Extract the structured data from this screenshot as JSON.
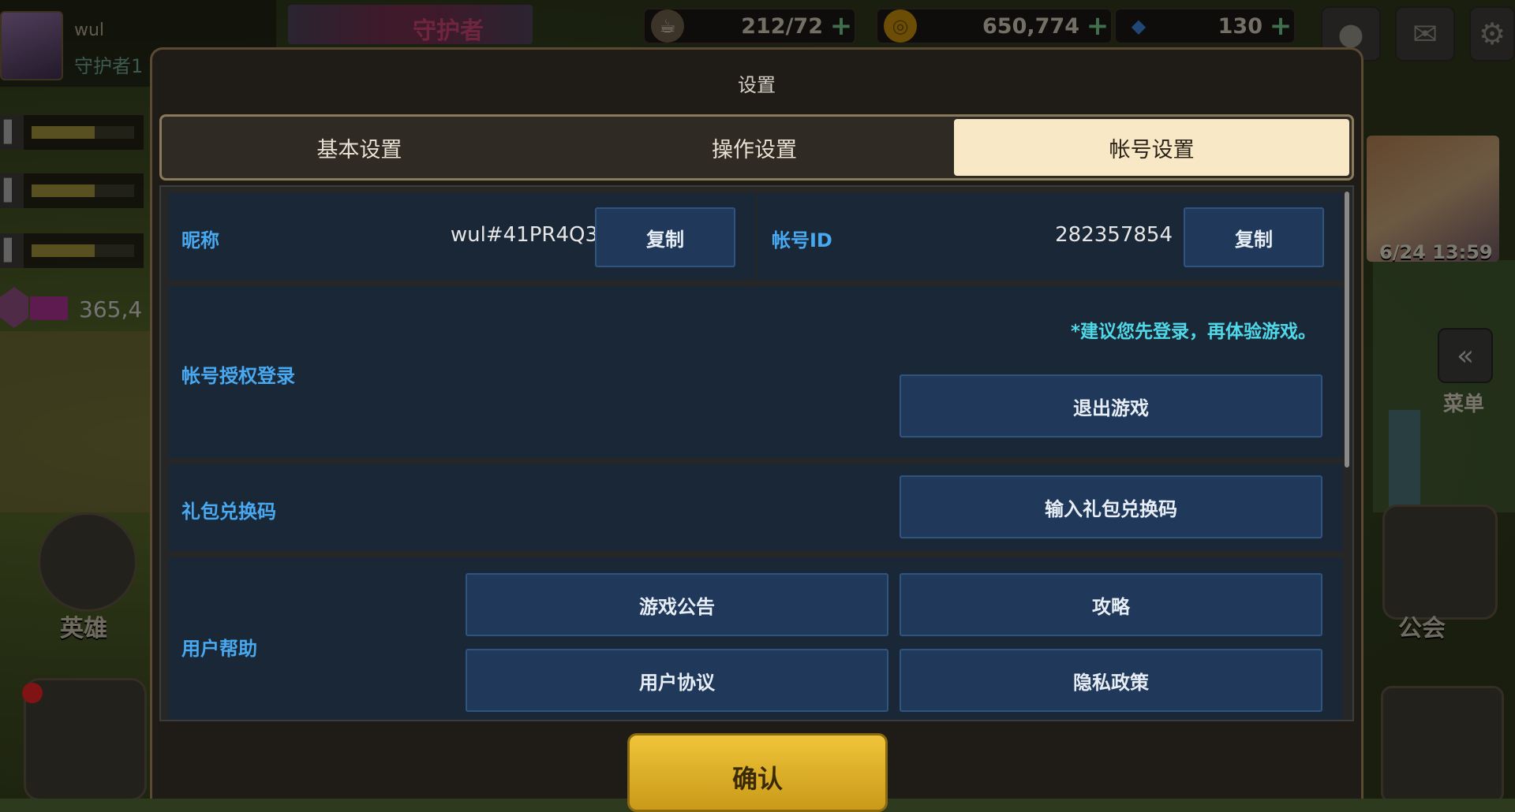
{
  "hud": {
    "player_name": "wul",
    "player_title": "守护者1",
    "guardian_banner": "守护者",
    "gem_value": "365,4",
    "resources": [
      {
        "icon": "coffee-cup-icon",
        "value": "212/72"
      },
      {
        "icon": "gold-coin-icon",
        "value": "650,774"
      },
      {
        "icon": "blue-diamond-icon",
        "value": "130"
      }
    ],
    "left_nav": [
      "英雄"
    ],
    "right_nav": {
      "menu": "菜单",
      "guild": "公会"
    },
    "event_date": "6/24 13:59"
  },
  "modal": {
    "title": "设置",
    "tabs": [
      {
        "label": "基本设置",
        "active": false
      },
      {
        "label": "操作设置",
        "active": false
      },
      {
        "label": "帐号设置",
        "active": true
      }
    ],
    "nickname": {
      "label": "昵称",
      "value": "wul#41PR4Q3",
      "copy": "复制"
    },
    "account_id": {
      "label": "帐号ID",
      "value": "282357854",
      "copy": "复制"
    },
    "auth": {
      "label": "帐号授权登录",
      "notice": "*建议您先登录，再体验游戏。",
      "logout": "退出游戏"
    },
    "gift": {
      "label": "礼包兑换码",
      "button": "输入礼包兑换码"
    },
    "help": {
      "label": "用户帮助",
      "buttons": [
        "游戏公告",
        "攻略",
        "用户协议",
        "隐私政策"
      ]
    },
    "confirm": "确认"
  },
  "colors": {
    "accent_label": "#48a8f0",
    "notice": "#4fd8e8",
    "tab_active": "#f8e8c6",
    "confirm": "#f0c43a"
  }
}
